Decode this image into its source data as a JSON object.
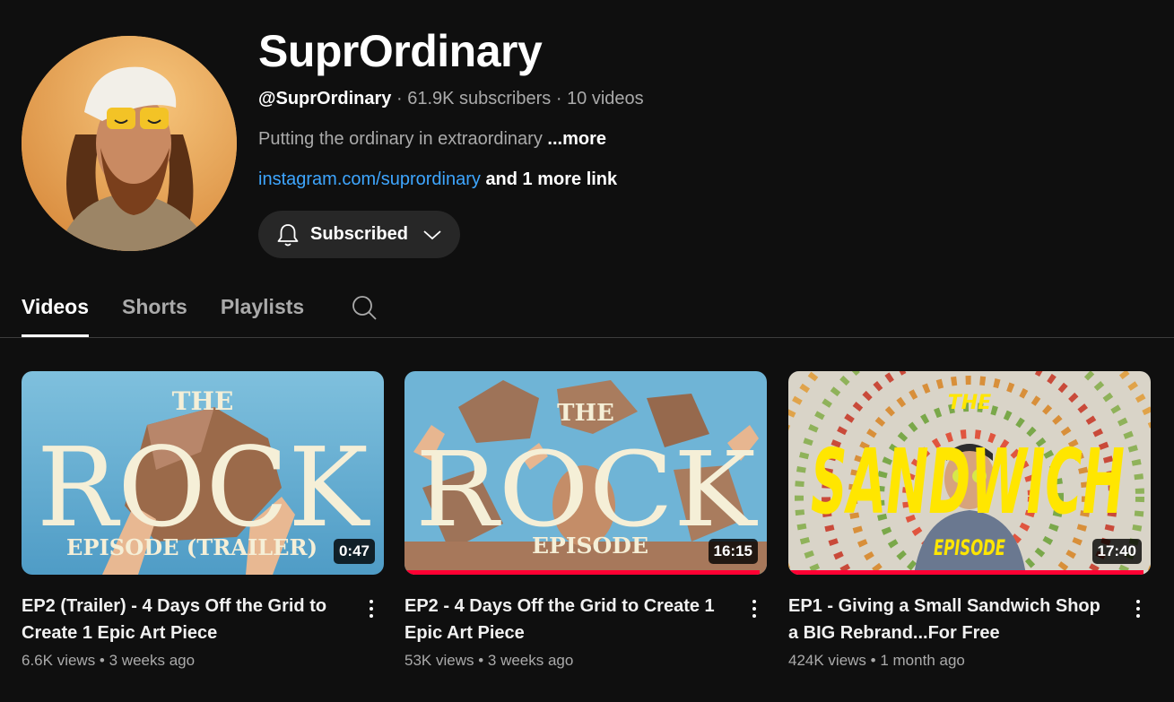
{
  "channel": {
    "name": "SuprOrdinary",
    "handle": "@SuprOrdinary",
    "subscribers": "61.9K subscribers",
    "video_count": "10 videos",
    "separator": " · ",
    "description": "Putting the ordinary in extraordinary",
    "description_more": "...more",
    "link": "instagram.com/suprordinary",
    "more_links": "and 1 more link",
    "subscribe_label": "Subscribed"
  },
  "tabs": [
    {
      "label": "Videos",
      "active": true
    },
    {
      "label": "Shorts",
      "active": false
    },
    {
      "label": "Playlists",
      "active": false
    }
  ],
  "videos": [
    {
      "title": "EP2 (Trailer) - 4 Days Off the Grid to Create 1 Epic Art Piece",
      "views": "6.6K views",
      "age": "3 weeks ago",
      "duration": "0:47",
      "thumb": {
        "top": "THE",
        "main": "ROCK",
        "bottom": "EPISODE (TRAILER)"
      },
      "watched": 0
    },
    {
      "title": "EP2 - 4 Days Off the Grid to Create 1 Epic Art Piece",
      "views": "53K views",
      "age": "3 weeks ago",
      "duration": "16:15",
      "thumb": {
        "top": "THE",
        "main": "ROCK",
        "bottom": "EPISODE"
      },
      "watched": 0.98
    },
    {
      "title": "EP1 - Giving a Small Sandwich Shop a BIG Rebrand...For Free",
      "views": "424K views",
      "age": "1 month ago",
      "duration": "17:40",
      "thumb": {
        "top": "THE",
        "main": "SANDWICH",
        "bottom": "EPISODE"
      },
      "watched": 0.98
    }
  ],
  "stats_separator": " • ",
  "colors": {
    "background": "#0f0f0f",
    "link": "#3ea6ff",
    "progress": "#ff0033",
    "sandwich_text": "#ffe600"
  }
}
